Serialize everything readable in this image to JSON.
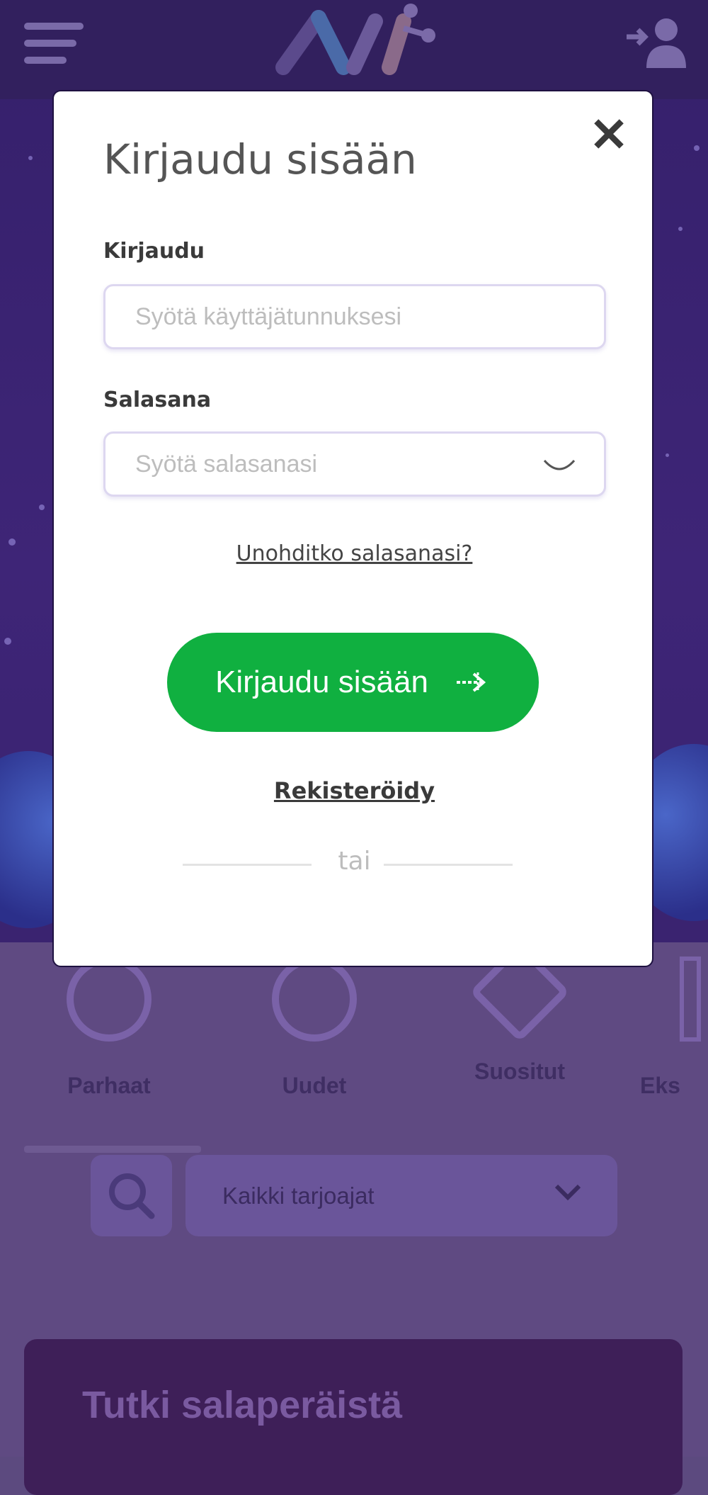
{
  "modal": {
    "title": "Kirjaudu sisään",
    "close_label": "✕",
    "username": {
      "label": "Kirjaudu",
      "placeholder": "Syötä käyttäjätunnuksesi",
      "value": ""
    },
    "password": {
      "label": "Salasana",
      "placeholder": "Syötä salasanasi",
      "value": ""
    },
    "forgot_link": "Unohditko salasanasi?",
    "login_button": "Kirjaudu sisään",
    "register_link": "Rekisteröidy",
    "divider_text": "tai"
  },
  "categories": [
    {
      "label": "Parhaat",
      "icon": "chip-icon"
    },
    {
      "label": "Uudet",
      "icon": "new-badge-icon"
    },
    {
      "label": "Suositut",
      "icon": "star-icon"
    },
    {
      "label": "Eks",
      "icon": "exclusive-icon"
    }
  ],
  "filters": {
    "provider_select": "Kaikki tarjoajat"
  },
  "promo": {
    "title": "Tutki salaperäistä"
  },
  "colors": {
    "accent_green": "#10b040",
    "header_purple": "#32205e",
    "overlay_purple": "#5f4a82"
  }
}
